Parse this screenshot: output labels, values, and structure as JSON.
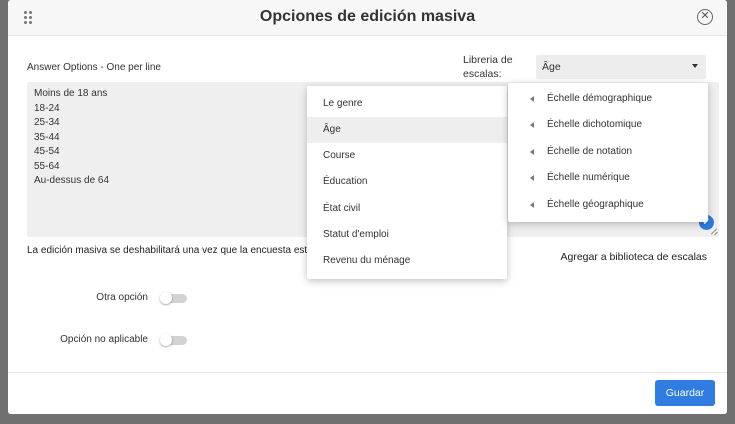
{
  "modal": {
    "title": "Opciones de edición masiva"
  },
  "answer_options": {
    "label": "Answer Options - One per line",
    "lines": [
      "Moins de 18 ans",
      "18-24",
      "25-34",
      "35-44",
      "45-54",
      "55-64",
      "Au-dessus de 64"
    ]
  },
  "library": {
    "label": "Libreria de escalas:",
    "selected": "Âge"
  },
  "notice": "La edición masiva se deshabilitará una vez que la encuesta esté",
  "add_library_label": "Agregar a biblioteca de escalas",
  "toggles": {
    "other_option": "Otra opción",
    "not_applicable": "Opción no aplicable"
  },
  "footer": {
    "save_label": "Guardar"
  },
  "menu": {
    "items": [
      "Le genre",
      "Âge",
      "Course",
      "Éducation",
      "État civil",
      "Statut d'emploi",
      "Revenu du ménage"
    ],
    "active_index": 1
  },
  "submenu": {
    "items": [
      "Échelle démographique",
      "Échelle dichotomique",
      "Échelle de notation",
      "Échelle numérique",
      "Échelle géographique"
    ]
  },
  "colors": {
    "accent": "#2f7de1",
    "backdrop": "#707070"
  }
}
